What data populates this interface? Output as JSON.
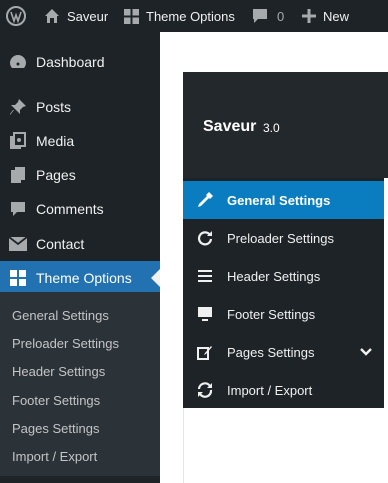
{
  "adminbar": {
    "site_name": "Saveur",
    "theme_options": "Theme Options",
    "comments_count": "0",
    "new_label": "New"
  },
  "menu": {
    "items": [
      {
        "label": "Dashboard",
        "icon": "dashboard-icon"
      },
      {
        "label": "Posts",
        "icon": "pin-icon"
      },
      {
        "label": "Media",
        "icon": "media-icon"
      },
      {
        "label": "Pages",
        "icon": "pages-icon"
      },
      {
        "label": "Comments",
        "icon": "comment-icon"
      },
      {
        "label": "Contact",
        "icon": "mail-icon"
      },
      {
        "label": "Theme Options",
        "icon": "grid-icon"
      }
    ],
    "submenu": [
      "General Settings",
      "Preloader Settings",
      "Header Settings",
      "Footer Settings",
      "Pages Settings",
      "Import / Export"
    ]
  },
  "panel": {
    "title": "Saveur",
    "version": "3.0",
    "nav": [
      {
        "label": "General Settings",
        "icon": "eyedropper-icon"
      },
      {
        "label": "Preloader Settings",
        "icon": "refresh-icon"
      },
      {
        "label": "Header Settings",
        "icon": "menu-lines-icon"
      },
      {
        "label": "Footer Settings",
        "icon": "monitor-icon"
      },
      {
        "label": "Pages Settings",
        "icon": "edit-icon"
      },
      {
        "label": "Import / Export",
        "icon": "sync-icon"
      }
    ]
  },
  "colors": {
    "accent": "#2271b1",
    "active_nav": "#0a7cc0",
    "dark": "#1d2327"
  }
}
